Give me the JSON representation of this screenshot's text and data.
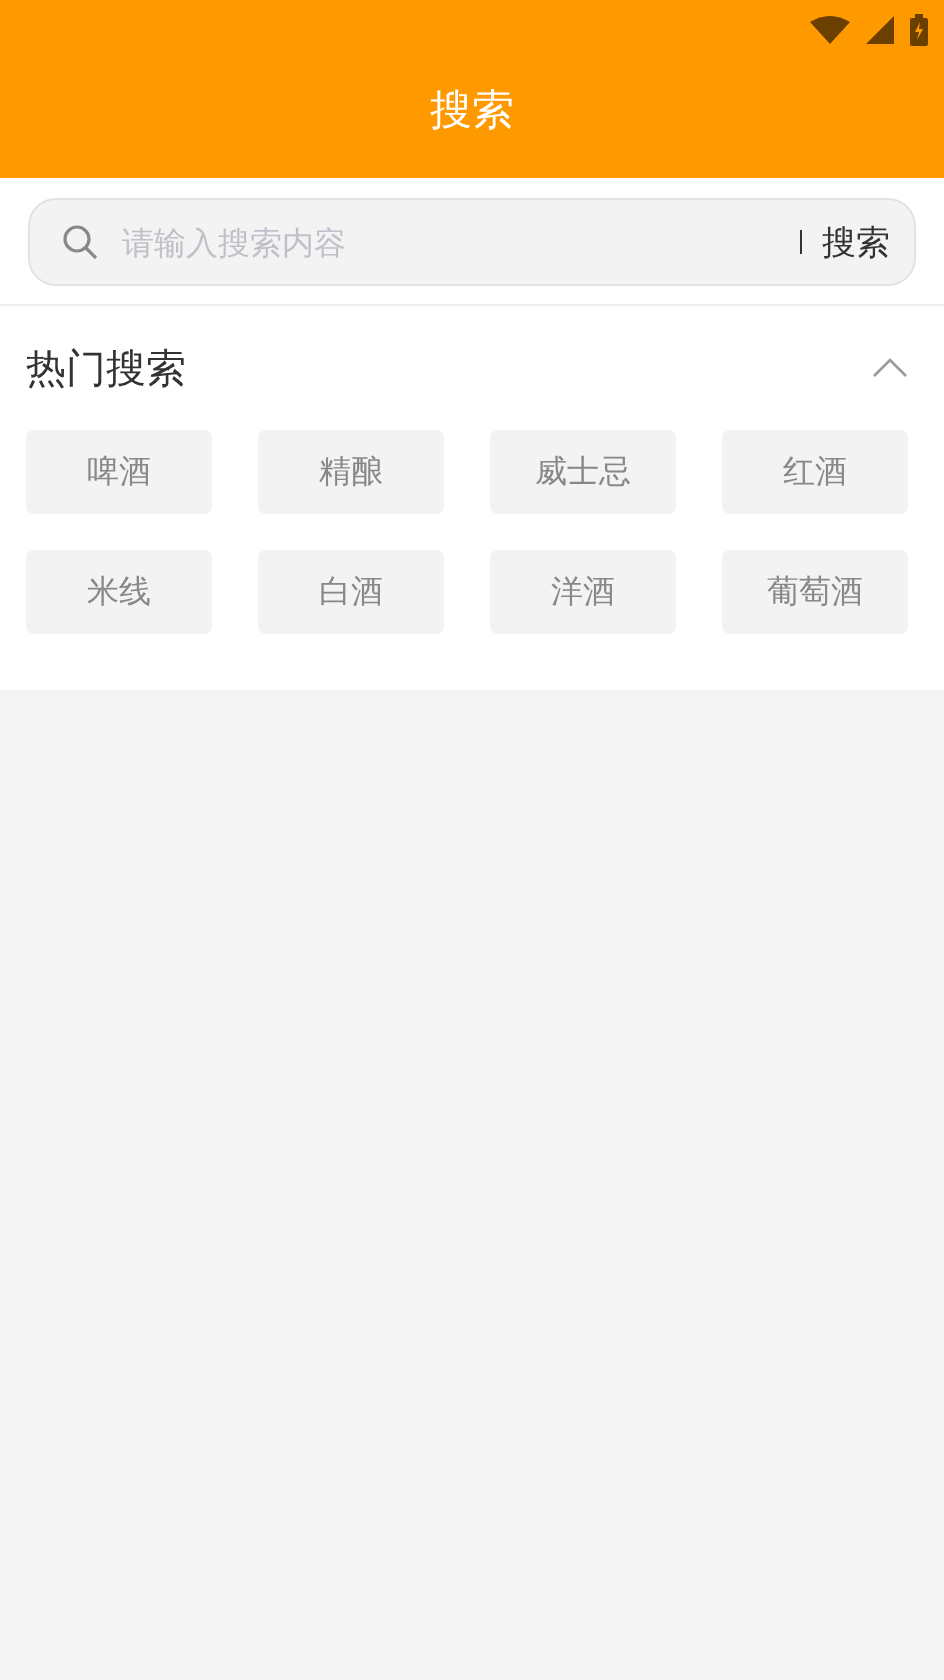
{
  "header": {
    "title": "搜索"
  },
  "search": {
    "placeholder": "请输入搜索内容",
    "button": "搜索"
  },
  "hot": {
    "title": "热门搜索",
    "expanded": true,
    "tags": [
      "啤酒",
      "精酿",
      "威士忌",
      "红酒",
      "米线",
      "白酒",
      "洋酒",
      "葡萄酒"
    ]
  }
}
